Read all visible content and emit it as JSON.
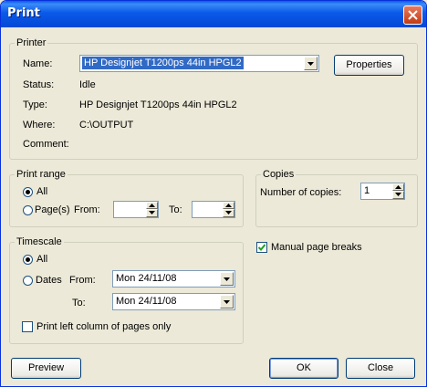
{
  "window": {
    "title": "Print"
  },
  "printer": {
    "group_label": "Printer",
    "name_label": "Name:",
    "name_value": "HP Designjet T1200ps 44in HPGL2",
    "properties_label": "Properties",
    "status_label": "Status:",
    "status_value": "Idle",
    "type_label": "Type:",
    "type_value": "HP Designjet T1200ps 44in HPGL2",
    "where_label": "Where:",
    "where_value": "C:\\OUTPUT",
    "comment_label": "Comment:",
    "comment_value": ""
  },
  "print_range": {
    "group_label": "Print range",
    "all_label": "All",
    "pages_label": "Page(s)",
    "from_label": "From:",
    "from_value": "",
    "to_label": "To:",
    "to_value": "",
    "selected": "all"
  },
  "copies": {
    "group_label": "Copies",
    "number_label": "Number of copies:",
    "number_value": "1"
  },
  "manual_breaks": {
    "label": "Manual page breaks",
    "checked": true
  },
  "timescale": {
    "group_label": "Timescale",
    "all_label": "All",
    "dates_label": "Dates",
    "from_label": "From:",
    "from_value": "Mon 24/11/08",
    "to_label": "To:",
    "to_value": "Mon 24/11/08",
    "left_column_label": "Print left column of pages only",
    "left_column_checked": false,
    "selected": "all"
  },
  "buttons": {
    "preview": "Preview",
    "ok": "OK",
    "close": "Close"
  },
  "icons": {
    "close": "close-icon",
    "dropdown": "chevron-down-icon",
    "spin_up": "chevron-up-icon",
    "spin_down": "chevron-down-icon",
    "check": "checkmark-icon"
  }
}
